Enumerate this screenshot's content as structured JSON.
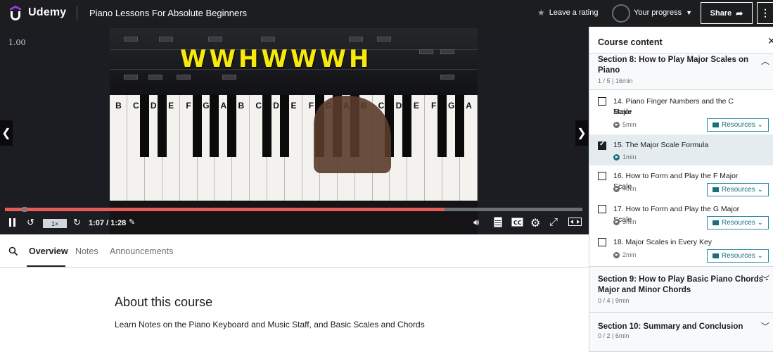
{
  "header": {
    "brand": "Udemy",
    "course_title": "Piano Lessons For Absolute Beginners",
    "rate_label": "Leave a rating",
    "progress_label": "Your progress",
    "share_label": "Share",
    "more_label": "⋮",
    "brand_color": "#a435f0",
    "logo_color": "#e8413c"
  },
  "video": {
    "speed_overlay": "1.00",
    "overlay_text": "WWHWWWH",
    "keyboard_notes": [
      "B",
      "C",
      "D",
      "E",
      "F",
      "G",
      "A",
      "B",
      "C",
      "D",
      "E",
      "F",
      "G",
      "A",
      "B",
      "C",
      "D",
      "E",
      "F",
      "G",
      "A"
    ],
    "playback_speed": "1×",
    "time_display": "1:07 / 1:28",
    "progress_fraction": 0.761,
    "buffered_fraction": 0.03
  },
  "tabs": {
    "items": [
      "Overview",
      "Notes",
      "Announcements"
    ],
    "active": "Overview"
  },
  "about": {
    "title": "About this course",
    "description": "Learn Notes on the Piano Keyboard and Music Staff, and Basic Scales and Chords"
  },
  "sidebar": {
    "title": "Course content",
    "section8": {
      "title_line1": "Section 8: How to Play Major Scales on",
      "title_line2": "Piano",
      "meta": "1 / 5 | 16min"
    },
    "lectures": [
      {
        "title_line1": "14. Piano Finger Numbers and the C Major",
        "title_line2": "Scale",
        "duration": "5min",
        "resources": "Resources",
        "checked": false
      },
      {
        "title_line1": "15. The Major Scale Formula",
        "title_line2": "",
        "duration": "1min",
        "resources": "",
        "checked": true
      },
      {
        "title_line1": "16. How to Form and Play the F Major Scale",
        "title_line2": "",
        "duration": "4min",
        "resources": "Resources",
        "checked": false
      },
      {
        "title_line1": "17. How to Form and Play the G Major Scale",
        "title_line2": "",
        "duration": "3min",
        "resources": "Resources",
        "checked": false
      },
      {
        "title_line1": "18. Major Scales in Every Key",
        "title_line2": "",
        "duration": "2min",
        "resources": "Resources",
        "checked": false
      }
    ],
    "section9": {
      "title_line1": "Section 9: How to Play Basic Piano Chords -",
      "title_line2": "Major and Minor Chords",
      "meta": "0 / 4 | 9min"
    },
    "section10": {
      "title_line1": "Section 10: Summary and Conclusion",
      "meta": "0 / 2 | 6min"
    }
  }
}
